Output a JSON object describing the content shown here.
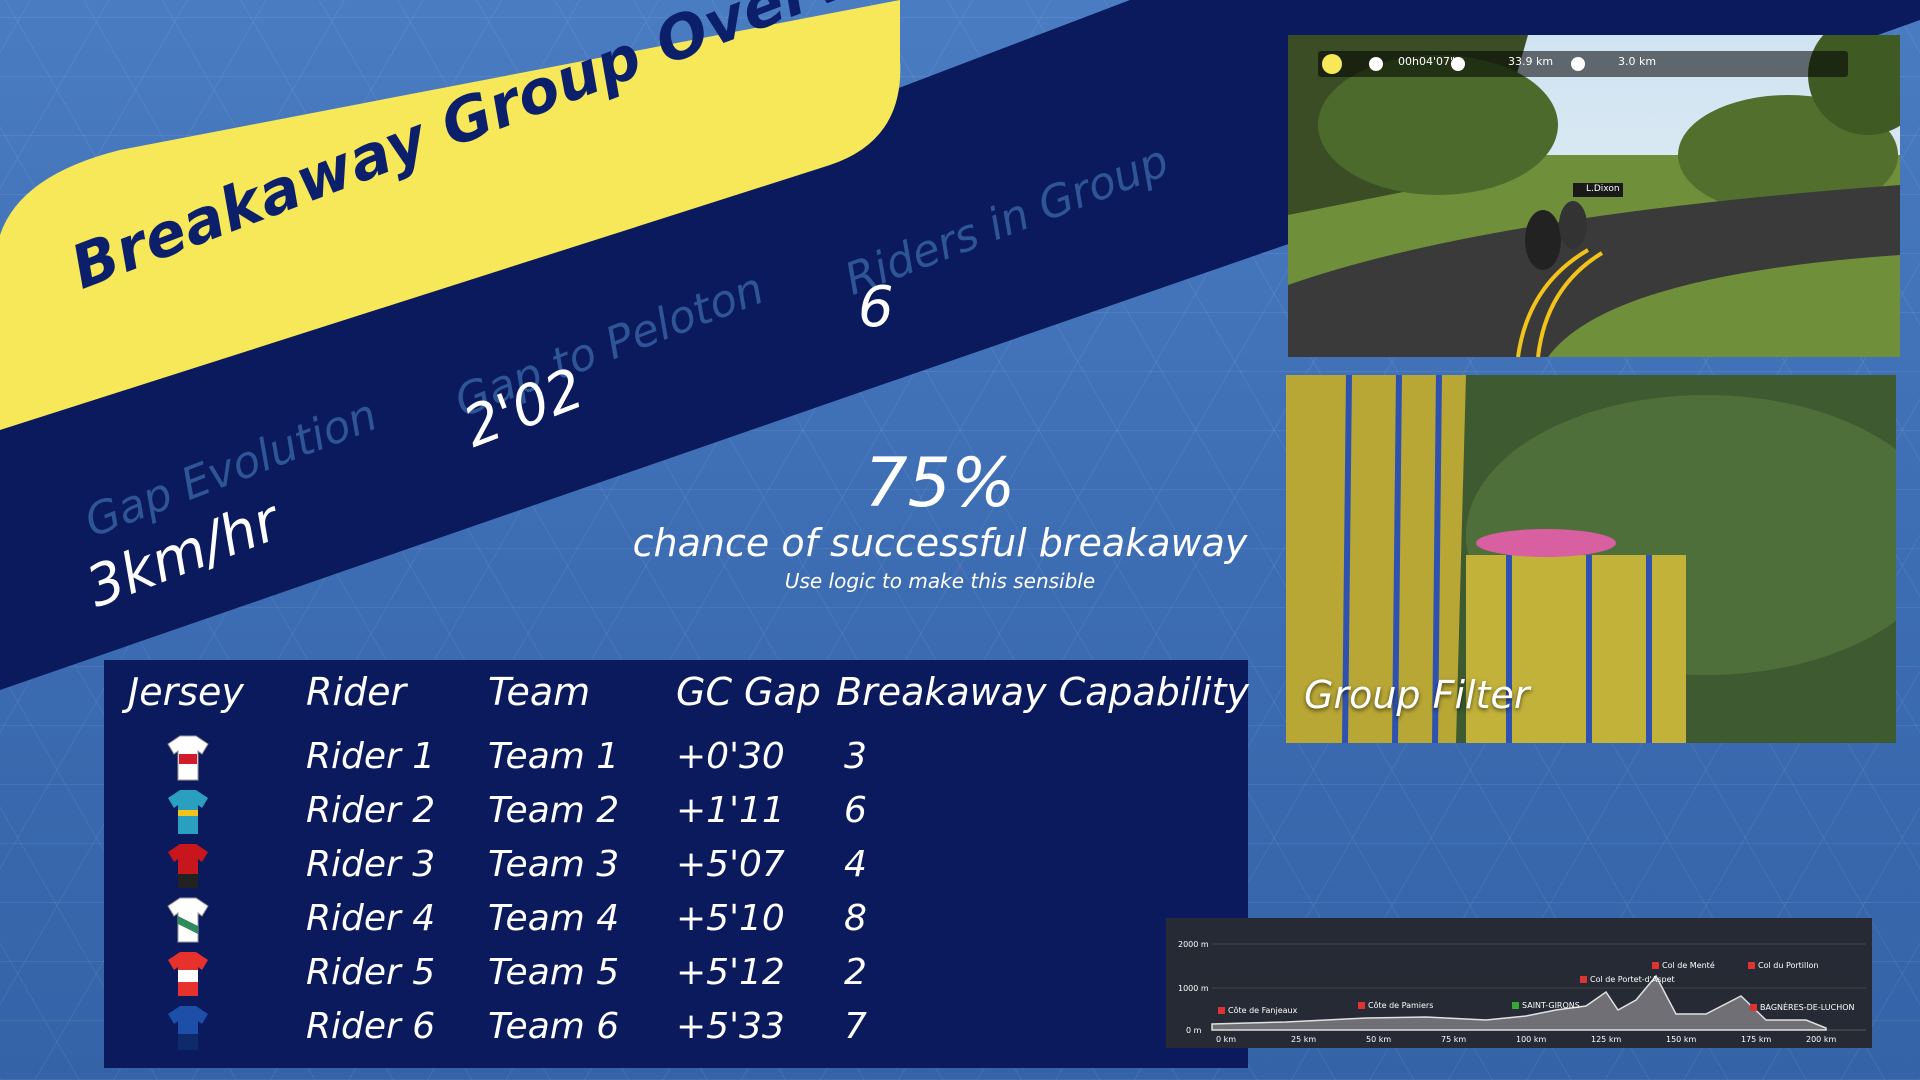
{
  "title": "Breakaway Group Overview",
  "stats": {
    "gap_evolution": {
      "label": "Gap Evolution",
      "value": "3km/hr"
    },
    "gap_to_peloton": {
      "label": "Gap to Peloton",
      "value": "2'02"
    },
    "riders_in_group": {
      "label": "Riders in Group",
      "value": "6"
    }
  },
  "probability": {
    "percent": "75%",
    "text": "chance of successful breakaway",
    "note": "Use logic to make this sensible"
  },
  "table": {
    "headers": {
      "jersey": "Jersey",
      "rider": "Rider",
      "team": "Team",
      "gc_gap": "GC Gap",
      "capability": "Breakaway Capability"
    },
    "rows": [
      {
        "rider": "Rider 1",
        "team": "Team 1",
        "gc_gap": "+0'30",
        "capability": "3",
        "jersey_colors": [
          "#ffffff",
          "#d11a2a"
        ]
      },
      {
        "rider": "Rider 2",
        "team": "Team 2",
        "gc_gap": "+1'11",
        "capability": "6",
        "jersey_colors": [
          "#2a9fbf",
          "#f2c318"
        ]
      },
      {
        "rider": "Rider 3",
        "team": "Team 3",
        "gc_gap": "+5'07",
        "capability": "4",
        "jersey_colors": [
          "#c8161d",
          "#222222"
        ]
      },
      {
        "rider": "Rider 4",
        "team": "Team 4",
        "gc_gap": "+5'10",
        "capability": "8",
        "jersey_colors": [
          "#ffffff",
          "#2f8c5a"
        ]
      },
      {
        "rider": "Rider 5",
        "team": "Team 5",
        "gc_gap": "+5'12",
        "capability": "2",
        "jersey_colors": [
          "#e6312c",
          "#ffffff"
        ]
      },
      {
        "rider": "Rider 6",
        "team": "Team 6",
        "gc_gap": "+5'33",
        "capability": "7",
        "jersey_colors": [
          "#1d4fa8",
          "#0e2a6b"
        ]
      }
    ]
  },
  "video_top": {
    "hud": {
      "time": "00h04'07\"",
      "distance": "33.9 km",
      "remaining": "3.0 km"
    },
    "rider_tag": "L.Dixon"
  },
  "video_bottom": {
    "label": "Group Filter"
  },
  "profile": {
    "y_ticks": [
      "2000 m",
      "1000 m",
      "0 m"
    ],
    "x_ticks": [
      "0 km",
      "25 km",
      "50 km",
      "75 km",
      "100 km",
      "125 km",
      "150 km",
      "175 km",
      "200 km"
    ],
    "climbs": [
      "Côte de Fanjeaux",
      "Côte de Pamiers",
      "SAINT-GIRONS",
      "Col de Portet-d'Aspet",
      "Col de Menté",
      "Col du Portillon",
      "BAGNÈRES-DE-LUCHON"
    ]
  },
  "colors": {
    "navy": "#0b1a5c",
    "yellow": "#f7e85a",
    "label_blue": "#2e5596"
  }
}
